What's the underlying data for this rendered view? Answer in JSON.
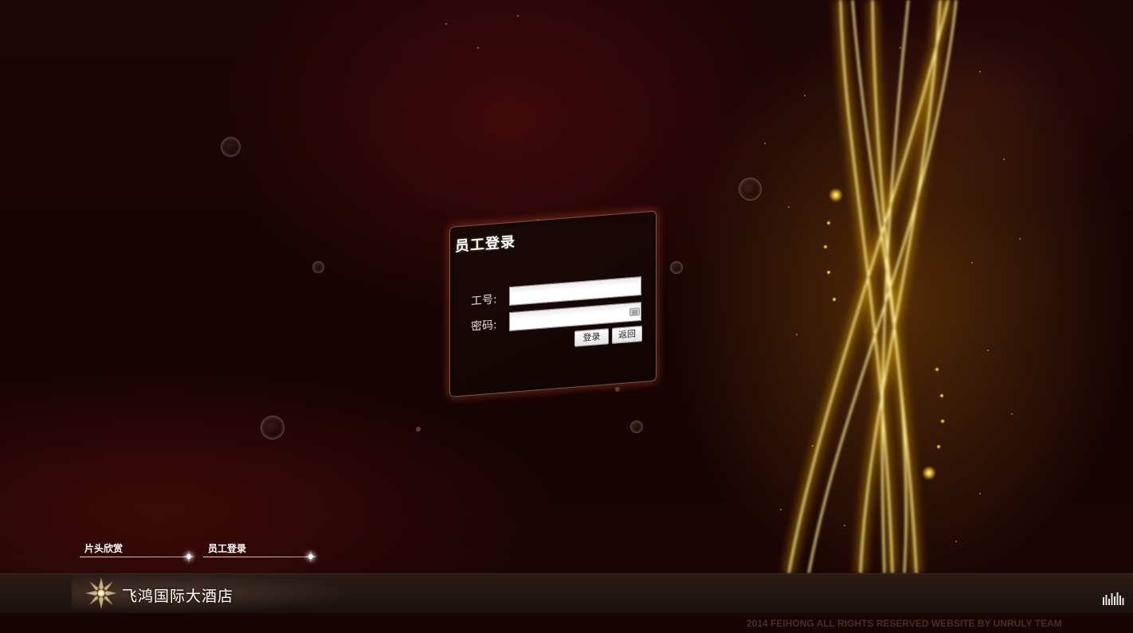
{
  "login": {
    "title": "员工登录",
    "employee_id_label": "工号:",
    "employee_id_value": "",
    "password_label": "密码:",
    "password_value": "",
    "login_button": "登录",
    "back_button": "返回"
  },
  "nav": {
    "items": [
      {
        "label": "片头欣赏"
      },
      {
        "label": "员工登录"
      }
    ]
  },
  "footer": {
    "brand_name": "飞鸿国际大酒店",
    "copyright": "2014 FEIHONG ALL RIGHTS RESERVED WEBSITE BY UNRULY TEAM",
    "music_icon": "equalizer-bars-icon",
    "logo_icon": "snowflake-emblem-icon"
  },
  "colors": {
    "background": "#1e0506",
    "light_streaks": "#ffe27a",
    "card_border": "#d79678",
    "footer_bar": "#2a1c17",
    "copyright_text": "#4a2e24"
  }
}
